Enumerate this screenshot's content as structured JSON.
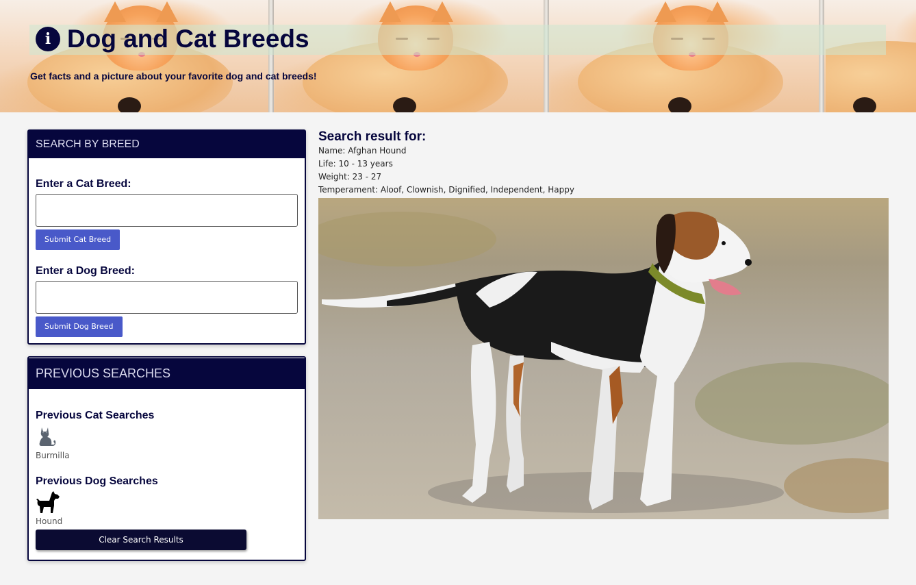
{
  "header": {
    "title": "Dog and Cat Breeds",
    "subtitle": "Get facts and a picture about your favorite dog and cat breeds!",
    "icon": "info-circle-icon"
  },
  "search_card": {
    "title": "SEARCH BY BREED",
    "cat_label": "Enter a Cat Breed:",
    "cat_value": "",
    "cat_button": "Submit Cat Breed",
    "dog_label": "Enter a Dog Breed:",
    "dog_value": "",
    "dog_button": "Submit Dog Breed"
  },
  "previous_card": {
    "title": "PREVIOUS SEARCHES",
    "cat_heading": "Previous Cat Searches",
    "cat_item": {
      "icon": "cat-icon",
      "label": "Burmilla"
    },
    "dog_heading": "Previous Dog Searches",
    "dog_item": {
      "icon": "dog-icon",
      "label": "Hound"
    },
    "clear_button": "Clear Search Results"
  },
  "result": {
    "heading": "Search result for:",
    "name": "Name: Afghan Hound",
    "life": "Life: 10 - 13 years",
    "weight": "Weight: 23 - 27",
    "temperament": "Temperament: Aloof, Clownish, Dignified, Independent, Happy"
  },
  "colors": {
    "navy": "#06063d",
    "button_blue": "#4959c9",
    "clear_button": "#0b0b32",
    "background": "#f4f4f4"
  }
}
